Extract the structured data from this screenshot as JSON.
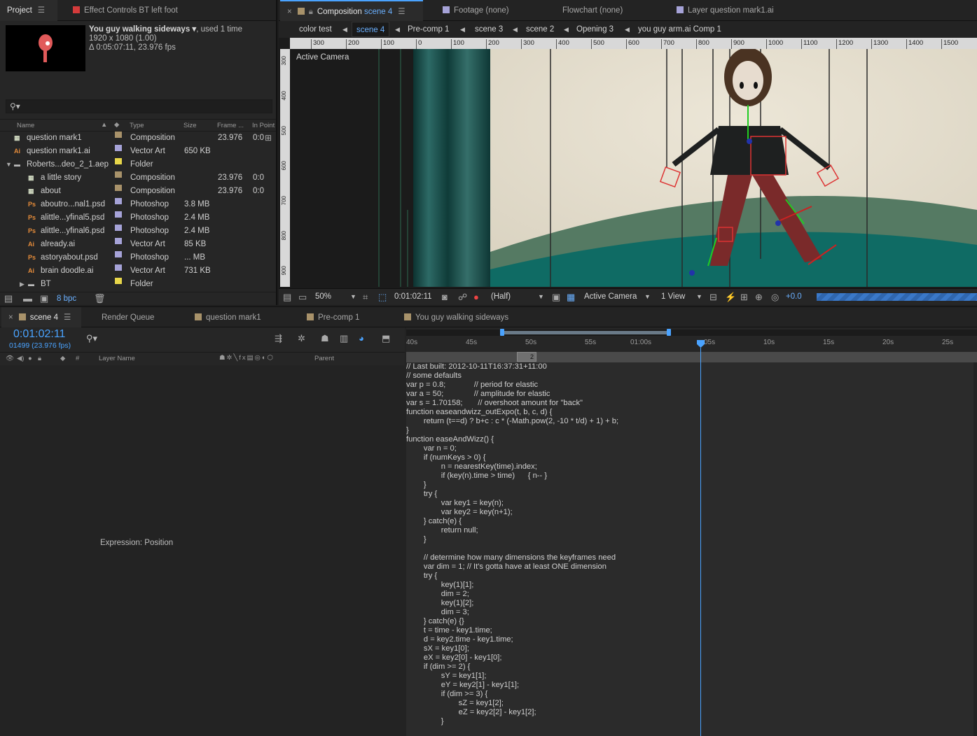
{
  "project_panel": {
    "tab_label": "Project",
    "effect_tab_label": "Effect Controls BT left foot",
    "selected_item_name": "You guy walking sideways ▾",
    "selected_item_used": ", used 1 time",
    "selected_item_dims": "1920 x 1080 (1.00)",
    "selected_item_duration": "Δ 0:05:07:11, 23.976 fps",
    "search_icon": "search-icon",
    "columns": {
      "name": "Name",
      "type": "Type",
      "size": "Size",
      "frame": "Frame ...",
      "inpoint": "In Point"
    },
    "items": [
      {
        "name": "question mark1",
        "type": "Composition",
        "size": "",
        "frame": "23.976",
        "inpoint": "0:0",
        "icon": "composition-icon",
        "label_color": "#a8926a"
      },
      {
        "name": "question mark1.ai",
        "type": "Vector Art",
        "size": "650 KB",
        "frame": "",
        "inpoint": "",
        "icon": "illustrator-file-icon",
        "label_color": "#a6a3d8"
      },
      {
        "name": "Roberts...deo_2_1.aep",
        "type": "Folder",
        "size": "",
        "frame": "",
        "inpoint": "",
        "icon": "folder-icon",
        "label_color": "#e7d64a"
      },
      {
        "name": "a little story",
        "type": "Composition",
        "size": "",
        "frame": "23.976",
        "inpoint": "0:0",
        "icon": "composition-icon",
        "label_color": "#a8926a"
      },
      {
        "name": "about",
        "type": "Composition",
        "size": "",
        "frame": "23.976",
        "inpoint": "0:0",
        "icon": "composition-icon",
        "label_color": "#a8926a"
      },
      {
        "name": "aboutro...nal1.psd",
        "type": "Photoshop",
        "size": "3.8 MB",
        "frame": "",
        "inpoint": "",
        "icon": "photoshop-file-icon",
        "label_color": "#a6a3d8"
      },
      {
        "name": "alittle...yfinal5.psd",
        "type": "Photoshop",
        "size": "2.4 MB",
        "frame": "",
        "inpoint": "",
        "icon": "photoshop-file-icon",
        "label_color": "#a6a3d8"
      },
      {
        "name": "alittle...yfinal6.psd",
        "type": "Photoshop",
        "size": "2.4 MB",
        "frame": "",
        "inpoint": "",
        "icon": "photoshop-file-icon",
        "label_color": "#a6a3d8"
      },
      {
        "name": "already.ai",
        "type": "Vector Art",
        "size": "85 KB",
        "frame": "",
        "inpoint": "",
        "icon": "illustrator-file-icon",
        "label_color": "#a6a3d8"
      },
      {
        "name": "astoryabout.psd",
        "type": "Photoshop",
        "size": "... MB",
        "frame": "",
        "inpoint": "",
        "icon": "photoshop-file-icon",
        "label_color": "#a6a3d8"
      },
      {
        "name": "brain doodle.ai",
        "type": "Vector Art",
        "size": "731 KB",
        "frame": "",
        "inpoint": "",
        "icon": "illustrator-file-icon",
        "label_color": "#a6a3d8"
      },
      {
        "name": "BT",
        "type": "Folder",
        "size": "",
        "frame": "",
        "inpoint": "",
        "icon": "folder-icon",
        "label_color": "#e7d64a"
      }
    ],
    "bpc_label": "8 bpc"
  },
  "viewer": {
    "tabs": [
      {
        "label": "Composition",
        "suffix": "scene 4"
      },
      {
        "label": "Footage (none)"
      },
      {
        "label": "Flowchart (none)"
      },
      {
        "label": "Layer question mark1.ai"
      }
    ],
    "breadcrumbs": [
      "color test",
      "scene 4",
      "Pre-comp 1",
      "scene 3",
      "scene 2",
      "Opening 3",
      "you guy arm.ai Comp 1"
    ],
    "ruler_ticks": [
      "300",
      "200",
      "100",
      "0",
      "100",
      "200",
      "300",
      "400",
      "500",
      "600",
      "700",
      "800",
      "900",
      "1000",
      "1100",
      "1200",
      "1300",
      "1400",
      "1500"
    ],
    "vertical_ticks": [
      "300",
      "400",
      "500",
      "600",
      "700",
      "800",
      "900"
    ],
    "camera_label": "Active Camera",
    "footer": {
      "zoom": "50%",
      "timecode": "0:01:02:11",
      "resolution": "(Half)",
      "camera": "Active Camera",
      "views": "1 View",
      "exposure": "+0.0"
    }
  },
  "timeline": {
    "tabs": [
      {
        "label": "scene 4",
        "color": "#a8926a"
      },
      {
        "label": "Render Queue",
        "color": ""
      },
      {
        "label": "question mark1",
        "color": "#a8926a"
      },
      {
        "label": "Pre-comp 1",
        "color": "#a8926a"
      },
      {
        "label": "You guy walking sideways",
        "color": "#a8926a"
      }
    ],
    "current_time": "0:01:02:11",
    "frame_info": "01499 (23.976 fps)",
    "layer_columns": {
      "layer_name": "Layer Name",
      "parent": "Parent",
      "hash": "#"
    },
    "time_ticks": [
      "40s",
      "45s",
      "50s",
      "55s",
      "01:00s",
      "05s",
      "10s",
      "15s",
      "20s",
      "25s"
    ],
    "marker_label": "2",
    "expression_label": "Expression: Position",
    "expression_code": [
      "// Last built: 2012-10-11T16:37:31+11:00",
      "// some defaults",
      "var p = 0.8;             // period for elastic",
      "var a = 50;              // amplitude for elastic",
      "var s = 1.70158;       // overshoot amount for \"back\"",
      "function easeandwizz_outExpo(t, b, c, d) {",
      "        return (t==d) ? b+c : c * (-Math.pow(2, -10 * t/d) + 1) + b;",
      "}",
      "function easeAndWizz() {",
      "        var n = 0;",
      "        if (numKeys > 0) {",
      "                n = nearestKey(time).index;",
      "                if (key(n).time > time)      { n-- }",
      "        }",
      "        try {",
      "                var key1 = key(n);",
      "                var key2 = key(n+1);",
      "        } catch(e) {",
      "                return null;",
      "        }",
      "",
      "        // determine how many dimensions the keyframes need",
      "        var dim = 1; // It's gotta have at least ONE dimension",
      "        try {",
      "                key(1)[1];",
      "                dim = 2;",
      "                key(1)[2];",
      "                dim = 3;",
      "        } catch(e) {}",
      "        t = time - key1.time;",
      "        d = key2.time - key1.time;",
      "        sX = key1[0];",
      "        eX = key2[0] - key1[0];",
      "        if (dim >= 2) {",
      "                sY = key1[1];",
      "                eY = key2[1] - key1[1];",
      "                if (dim >= 3) {",
      "                        sZ = key1[2];",
      "                        eZ = key2[2] - key1[2];",
      "                }"
    ]
  },
  "colors": {
    "accent": "#4aa3ff",
    "highlight_blue": "#6ab0ff",
    "composition_label": "#a8926a",
    "vector_label": "#a6a3d8",
    "folder_label": "#e7d64a",
    "tab_red": "#d43b3b"
  }
}
